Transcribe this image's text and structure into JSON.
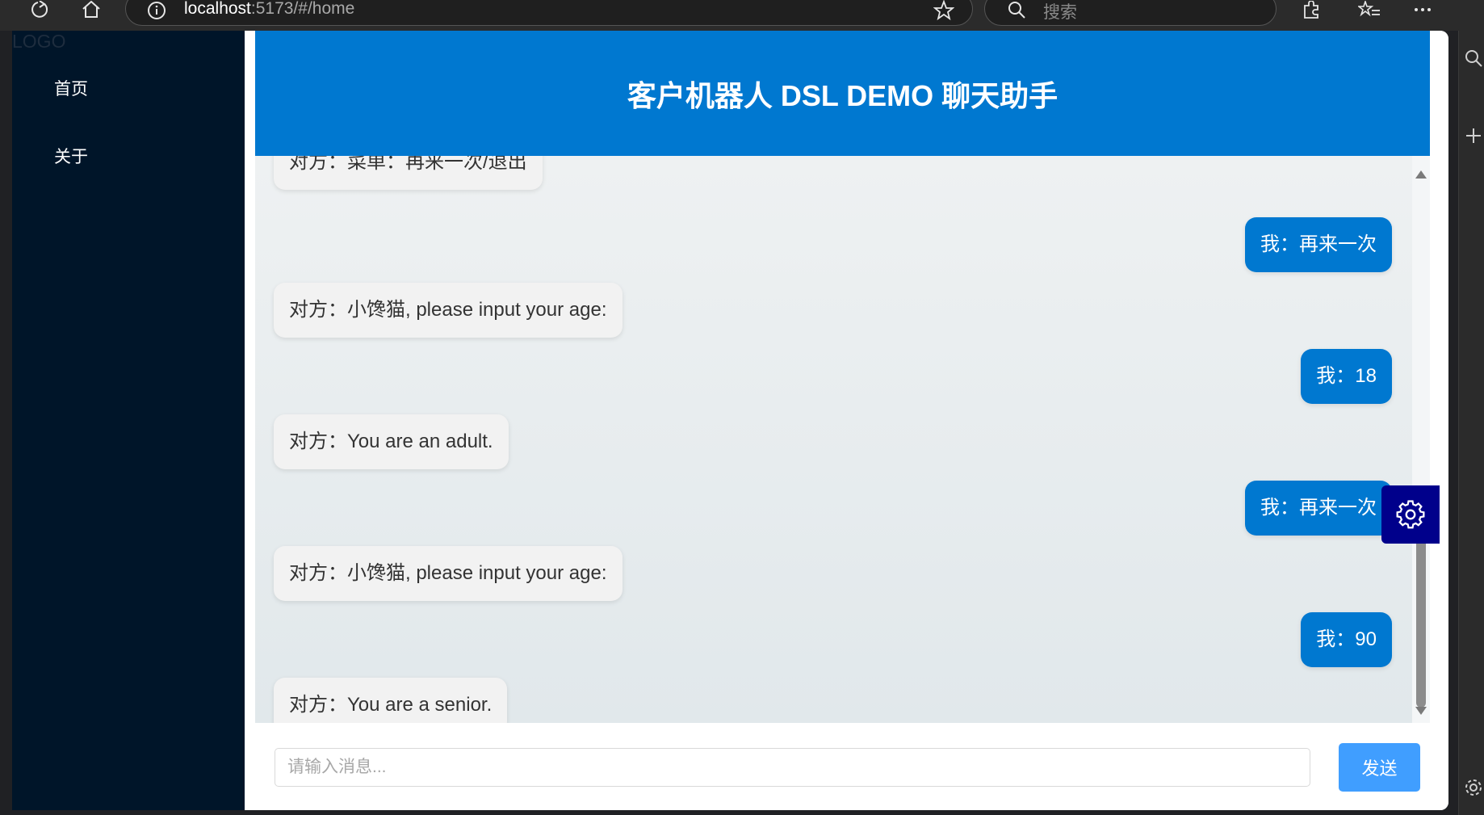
{
  "browser": {
    "url_host": "localhost",
    "url_path": ":5173/#/home",
    "search_placeholder": "搜索"
  },
  "sidebar": {
    "logo": "LOGO",
    "items": [
      {
        "label": "首页"
      },
      {
        "label": "关于"
      }
    ]
  },
  "chat": {
    "title": "客户机器人 DSL DEMO 聊天助手",
    "messages": [
      {
        "from": "other",
        "text": "对方：菜单：再来一次/退出"
      },
      {
        "from": "me",
        "text": "我：再来一次"
      },
      {
        "from": "other",
        "text": "对方：小馋猫, please input your age:"
      },
      {
        "from": "me",
        "text": "我：18"
      },
      {
        "from": "other",
        "text": "对方：You are an adult."
      },
      {
        "from": "me",
        "text": "我：再来一次"
      },
      {
        "from": "other",
        "text": "对方：小馋猫, please input your age:"
      },
      {
        "from": "me",
        "text": "我：90"
      },
      {
        "from": "other",
        "text": "对方：You are a senior."
      }
    ],
    "input_placeholder": "请输入消息...",
    "input_value": "",
    "send_label": "发送"
  },
  "colors": {
    "header_bg": "#0078d0",
    "sidebar_bg": "#001529",
    "my_bubble": "#0078d0",
    "other_bubble": "#f2f2f2",
    "send_button": "#409eff",
    "settings_button": "#00008b"
  },
  "icons": [
    "refresh-icon",
    "home-icon",
    "info-icon",
    "star-icon",
    "search-icon",
    "extensions-icon",
    "favorites-icon",
    "more-icon",
    "gear-icon"
  ]
}
